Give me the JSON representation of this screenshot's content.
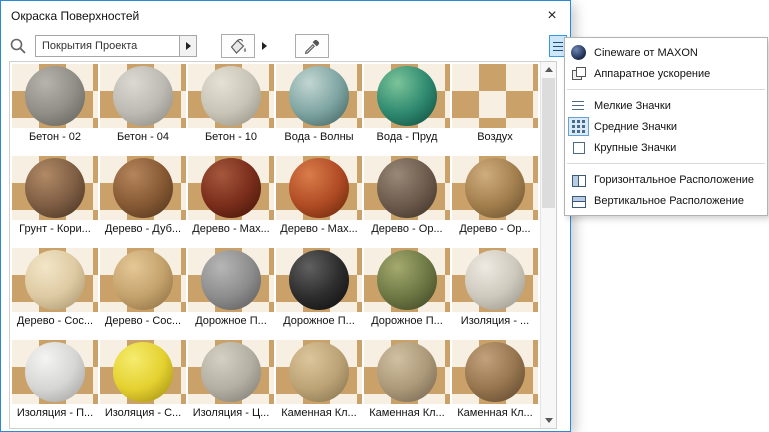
{
  "window": {
    "title": "Окраска Поверхностей",
    "close": "×"
  },
  "toolbar": {
    "search_icon": "magnifier-icon",
    "catalog_value": "Покрытия Проекта",
    "paint_icon": "paint-bucket-icon",
    "picker_icon": "eyedropper-icon",
    "menu_button_icon": "list-settings-icon"
  },
  "materials": [
    {
      "label": "Бетон - 02",
      "hi": "#b6b4ac",
      "mid": "#908e86",
      "lo": "#60605a"
    },
    {
      "label": "Бетон - 04",
      "hi": "#dbd9d2",
      "mid": "#bcbab2",
      "lo": "#8a887f"
    },
    {
      "label": "Бетон - 10",
      "hi": "#e5e1d5",
      "mid": "#c8c4b6",
      "lo": "#938f82"
    },
    {
      "label": "Вода - Волны",
      "hi": "#c2d6d2",
      "mid": "#7fa5a2",
      "lo": "#3e615e"
    },
    {
      "label": "Вода - Пруд",
      "hi": "#7cc49a",
      "mid": "#2f8a70",
      "lo": "#0e4a3e"
    },
    {
      "label": "Воздух",
      "sphere": false,
      "hi": "",
      "mid": "",
      "lo": ""
    },
    {
      "label": "Грунт - Кори...",
      "hi": "#b18a66",
      "mid": "#7f5e44",
      "lo": "#463222"
    },
    {
      "label": "Дерево - Дуб...",
      "hi": "#b5855c",
      "mid": "#875a34",
      "lo": "#50331c"
    },
    {
      "label": "Дерево - Мах...",
      "hi": "#a5573d",
      "mid": "#7a2e1b",
      "lo": "#441407"
    },
    {
      "label": "Дерево - Мах...",
      "hi": "#d97c4a",
      "mid": "#b14c25",
      "lo": "#672509"
    },
    {
      "label": "Дерево - Ор...",
      "hi": "#988876",
      "mid": "#6d5b4d",
      "lo": "#3e3127"
    },
    {
      "label": "Дерево - Ор...",
      "hi": "#d0ad7e",
      "mid": "#a37f4e",
      "lo": "#68502e"
    },
    {
      "label": "Дерево - Сос...",
      "hi": "#f2e6c8",
      "mid": "#decaa2",
      "lo": "#a6926c"
    },
    {
      "label": "Дерево - Сос...",
      "hi": "#e4c897",
      "mid": "#c4a26c",
      "lo": "#8a6c40"
    },
    {
      "label": "Дорожное П...",
      "hi": "#b6b6b6",
      "mid": "#8d8d8d",
      "lo": "#585858"
    },
    {
      "label": "Дорожное П...",
      "hi": "#606060",
      "mid": "#2d2d2d",
      "lo": "#0d0d0d"
    },
    {
      "label": "Дорожное П...",
      "hi": "#a4aa6e",
      "mid": "#6d7845",
      "lo": "#3c4522"
    },
    {
      "label": "Изоляция - ...",
      "hi": "#eeeae2",
      "mid": "#cec9bd",
      "lo": "#969288"
    },
    {
      "label": "Изоляция - П...",
      "hi": "#f4f4f2",
      "mid": "#d6d6d4",
      "lo": "#9e9e9c"
    },
    {
      "label": "Изоляция - С...",
      "hi": "#f6ec6e",
      "mid": "#e4d130",
      "lo": "#a08c0e"
    },
    {
      "label": "Изоляция - Ц...",
      "hi": "#d4d0c4",
      "mid": "#b3afa3",
      "lo": "#7d7970"
    },
    {
      "label": "Каменная Кл...",
      "hi": "#ddc59b",
      "mid": "#bca376",
      "lo": "#83704d"
    },
    {
      "label": "Каменная Кл...",
      "hi": "#d1c0a3",
      "mid": "#ac9979",
      "lo": "#73634f"
    },
    {
      "label": "Каменная Кл...",
      "hi": "#c2a27c",
      "mid": "#96754f",
      "lo": "#5c452a"
    }
  ],
  "context_menu": {
    "items": [
      {
        "label": "Cineware от MAXON",
        "icon": "cineware"
      },
      {
        "label": "Аппаратное ускорение",
        "icon": "hardware-acceleration"
      },
      {
        "type": "separator"
      },
      {
        "label": "Мелкие Значки",
        "icon": "small-icons"
      },
      {
        "label": "Средние Значки",
        "icon": "medium-icons",
        "selected": true
      },
      {
        "label": "Крупные Значки",
        "icon": "large-icons"
      },
      {
        "type": "separator"
      },
      {
        "label": "Горизонтальное Расположение",
        "icon": "horizontal-layout"
      },
      {
        "label": "Вертикальное Расположение",
        "icon": "vertical-layout"
      }
    ]
  },
  "colors": {
    "window_border": "#2a8ad4",
    "checker_tan": "#c9a169",
    "checker_light": "#f6efe2",
    "menu_selected_border": "#66a1d2"
  }
}
